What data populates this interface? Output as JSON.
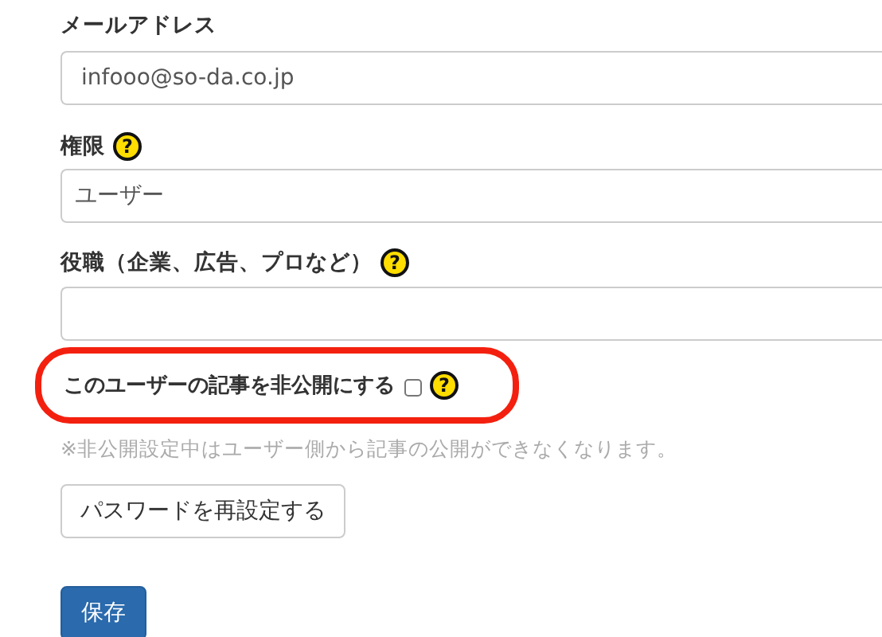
{
  "fields": [
    {
      "label": "メールアドレス",
      "value": "infooo@so-da.co.jp",
      "kind": "text"
    },
    {
      "label": "権限",
      "help": "?",
      "value": "ユーザー",
      "kind": "select"
    },
    {
      "label": "役職（企業、広告、プロなど）",
      "help": "?",
      "kind": "text"
    }
  ],
  "private_option": {
    "label": "このユーザーの記事を非公開にする",
    "checked": false,
    "help": "?",
    "highlighted": true
  },
  "note": "※非公開設定中はユーザー側から記事の公開ができなくなります。",
  "buttons": [
    {
      "label": "パスワードを再設定する",
      "kind": "default"
    },
    {
      "label": "保存",
      "kind": "primary"
    }
  ]
}
